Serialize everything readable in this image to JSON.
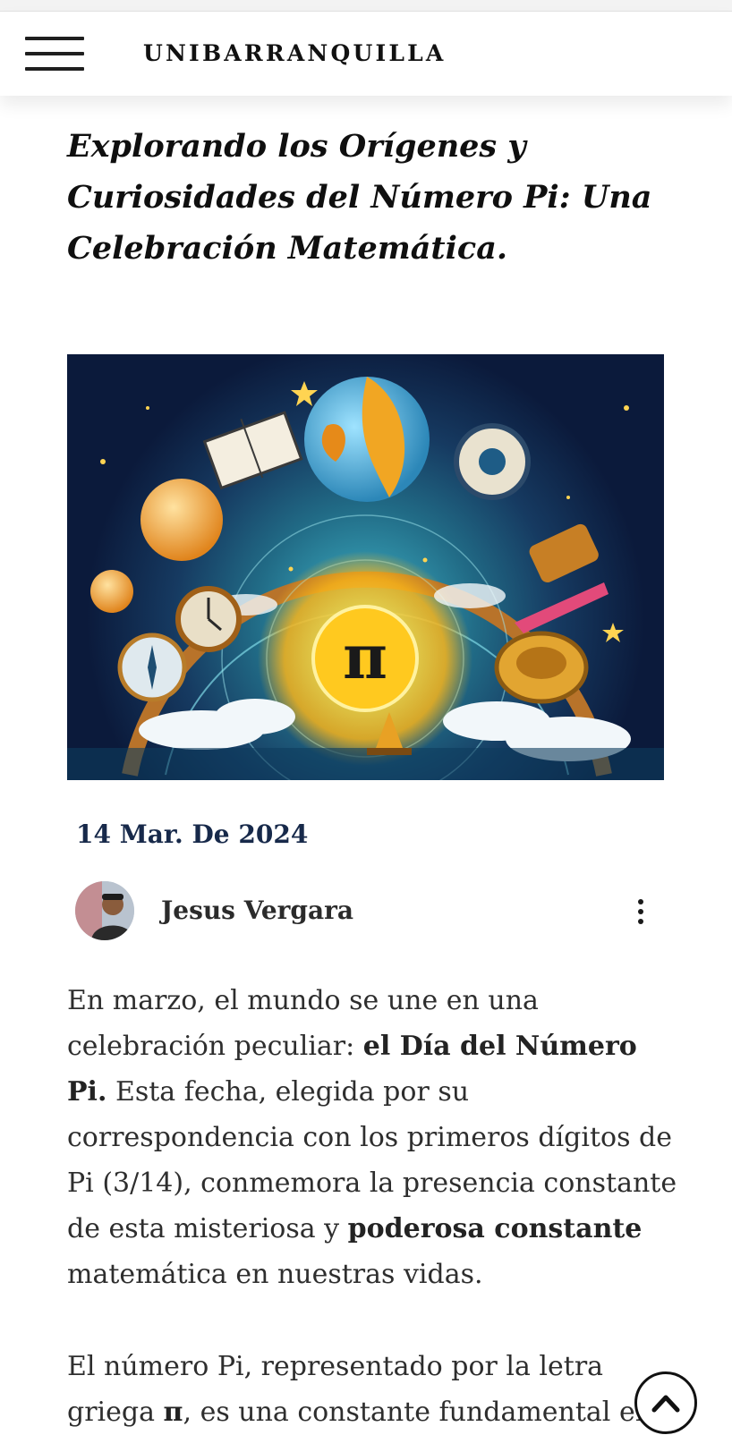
{
  "header": {
    "brand": "UNIBARRANQUILLA",
    "menu_icon": "hamburger-menu-icon"
  },
  "article": {
    "title": "Explorando los Orígenes y Curiosidades del Número Pi: Una Celebración Matemática.",
    "hero_image_symbol": "π",
    "date": "14 Mar. De 2024",
    "author": {
      "name": "Jesus Vergara",
      "more_icon": "more-vertical-icon"
    },
    "paragraph1": {
      "t1": "En marzo, el mundo se une en una celebración peculiar: ",
      "b1": "el Día del Número Pi.",
      "t2": " Esta fecha, elegida por su correspondencia con los primeros dígitos de Pi (3/14), conmemora la presencia constante de esta misteriosa y ",
      "b2": "poderosa constante",
      "t3": " matemática en nuestras vidas."
    },
    "paragraph2": {
      "t1": "El número Pi, representado por la letra griega ",
      "b1": "π",
      "t2": ", es una constante fundamental en"
    }
  },
  "scroll_top": {
    "icon": "chevron-up-icon"
  }
}
